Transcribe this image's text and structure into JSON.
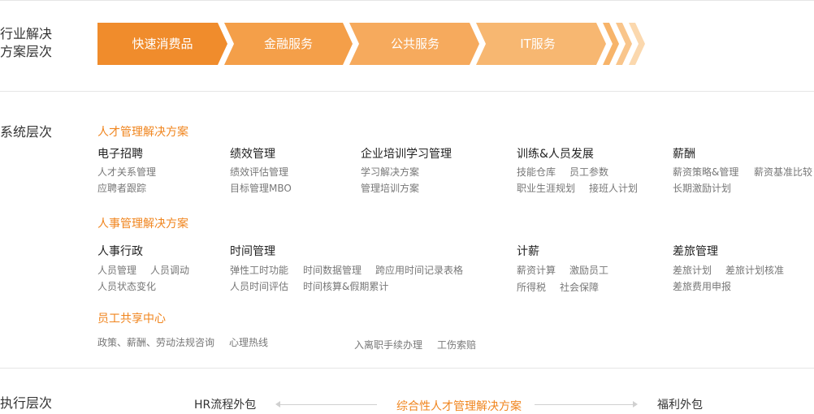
{
  "industry": {
    "title_line1": "行业解决",
    "title_line2": "方案层次",
    "steps": [
      {
        "label": "快速消费品",
        "color": "#f08c2c"
      },
      {
        "label": "金融服务",
        "color": "#f49f49"
      },
      {
        "label": "公共服务",
        "color": "#f6aa5d"
      },
      {
        "label": "IT服务",
        "color": "#f7b771"
      }
    ],
    "trail_colors": [
      "#f7b46a",
      "#f9c58b",
      "#fbd8ae"
    ]
  },
  "system": {
    "title": "系统层次",
    "sections": [
      {
        "title": "人才管理解决方案",
        "columns": [
          {
            "title": "电子招聘",
            "rows": [
              [
                "人才关系管理"
              ],
              [
                "应聘者跟踪"
              ]
            ]
          },
          {
            "title": "绩效管理",
            "rows": [
              [
                "绩效评估管理"
              ],
              [
                "目标管理MBO"
              ]
            ]
          },
          {
            "title": "企业培训学习管理",
            "rows": [
              [
                "学习解决方案"
              ],
              [
                "管理培训方案"
              ]
            ]
          },
          {
            "title": "训练&人员发展",
            "rows": [
              [
                "技能仓库",
                "员工参数"
              ],
              [
                "职业生涯规划",
                "接班人计划"
              ]
            ]
          },
          {
            "title": "薪酬",
            "rows": [
              [
                "薪资策略&管理",
                "薪资基准比较"
              ],
              [
                "长期激励计划"
              ]
            ]
          }
        ]
      },
      {
        "title": "人事管理解决方案",
        "columns": [
          {
            "title": "人事行政",
            "rows": [
              [
                "人员管理",
                "人员调动"
              ],
              [
                "人员状态变化"
              ]
            ]
          },
          {
            "title": "时间管理",
            "rows": [
              [
                "弹性工时功能",
                "时间数据管理",
                "跨应用时间记录表格"
              ],
              [
                "人员时间评估",
                "时间核算&假期累计"
              ]
            ]
          },
          {
            "title": "计薪",
            "rows": [
              [
                "薪资计算",
                "激励员工"
              ],
              [
                "所得税",
                "社会保障"
              ]
            ]
          },
          {
            "title": "差旅管理",
            "rows": [
              [
                "差旅计划",
                "差旅计划核准"
              ],
              [
                "差旅费用申报"
              ]
            ]
          }
        ]
      },
      {
        "title": "员工共享中心",
        "groups": [
          [
            "政策、薪酬、劳动法规咨询",
            "心理热线"
          ],
          [
            "入离职手续办理",
            "工伤索赔"
          ]
        ]
      }
    ]
  },
  "execution": {
    "title": "执行层次",
    "left": "HR流程外包",
    "center": "综合性人才管理解决方案",
    "right": "福利外包"
  }
}
